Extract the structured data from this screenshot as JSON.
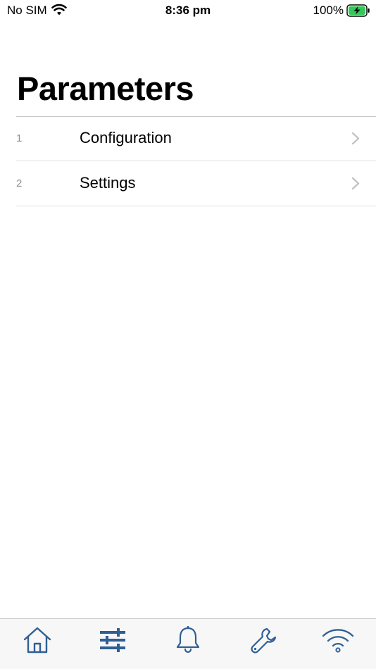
{
  "status_bar": {
    "carrier": "No SIM",
    "time": "8:36 pm",
    "battery_percent": "100%",
    "wifi_icon": "wifi-icon",
    "battery_icon": "battery-charging-icon",
    "battery_color": "#34c759"
  },
  "page": {
    "title": "Parameters"
  },
  "list": {
    "items": [
      {
        "index": "1",
        "label": "Configuration",
        "icon": "chevron-right-icon"
      },
      {
        "index": "2",
        "label": "Settings",
        "icon": "chevron-right-icon"
      }
    ]
  },
  "tab_bar": {
    "accent_color": "#2f5f95",
    "items": [
      {
        "name": "home",
        "icon": "home-icon"
      },
      {
        "name": "parameters",
        "icon": "sliders-icon"
      },
      {
        "name": "alarms",
        "icon": "bell-icon"
      },
      {
        "name": "tools",
        "icon": "wrench-icon"
      },
      {
        "name": "connection",
        "icon": "wifi-icon"
      }
    ]
  }
}
